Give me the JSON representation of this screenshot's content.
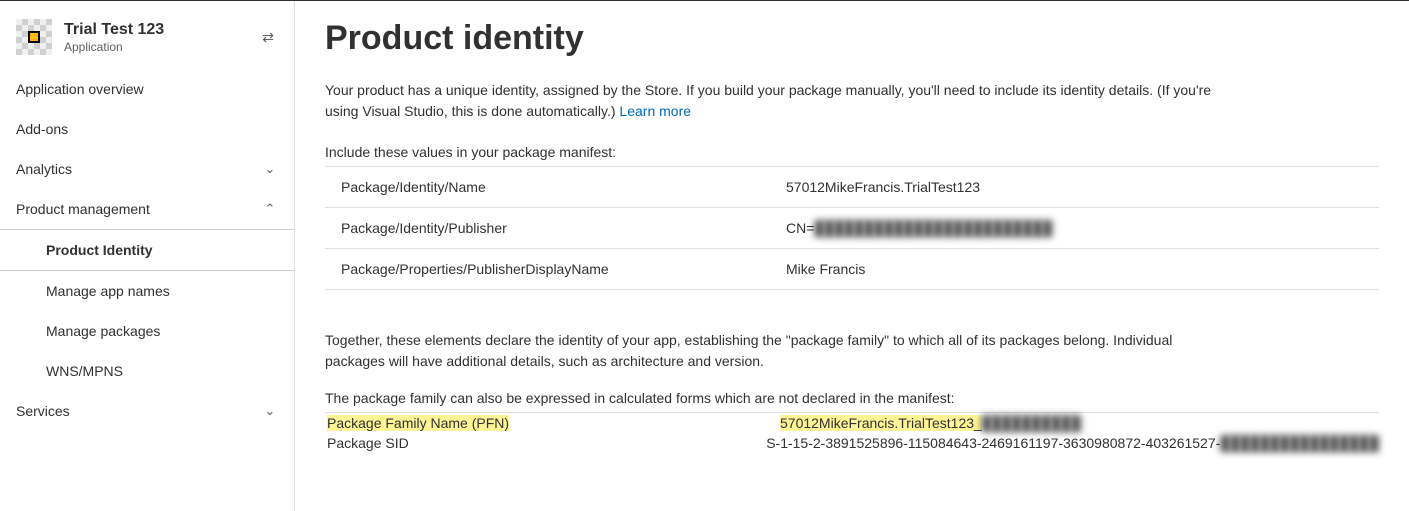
{
  "sidebar": {
    "app_title": "Trial Test 123",
    "app_subtitle": "Application",
    "items": [
      {
        "label": "Application overview",
        "kind": "link"
      },
      {
        "label": "Add-ons",
        "kind": "link"
      },
      {
        "label": "Analytics",
        "kind": "expandable",
        "expanded": false
      },
      {
        "label": "Product management",
        "kind": "expandable",
        "expanded": true,
        "children": [
          {
            "label": "Product Identity",
            "active": true
          },
          {
            "label": "Manage app names"
          },
          {
            "label": "Manage packages"
          },
          {
            "label": "WNS/MPNS"
          }
        ]
      },
      {
        "label": "Services",
        "kind": "expandable",
        "expanded": false
      }
    ]
  },
  "main": {
    "title": "Product identity",
    "description_pre": "Your product has a unique identity, assigned by the Store. If you build your package manually, you'll need to include its identity details. (If you're using Visual Studio, this is done automatically.)",
    "learn_more": "Learn more",
    "manifest_intro": "Include these values in your package manifest:",
    "manifest_rows": [
      {
        "key": "Package/Identity/Name",
        "value": "57012MikeFrancis.TrialTest123"
      },
      {
        "key": "Package/Identity/Publisher",
        "value_prefix": "CN=",
        "value_blurred": "████████████████████████"
      },
      {
        "key": "Package/Properties/PublisherDisplayName",
        "value": "Mike Francis"
      }
    ],
    "together_para": "Together, these elements declare the identity of your app, establishing the \"package family\" to which all of its packages belong. Individual packages will have additional details, such as architecture and version.",
    "calc_intro": "The package family can also be expressed in calculated forms which are not declared in the manifest:",
    "calc_rows": [
      {
        "key": "Package Family Name (PFN)",
        "value_prefix": "57012MikeFrancis.TrialTest123_",
        "value_blurred": "██████████",
        "highlight": true
      },
      {
        "key": "Package SID",
        "value_prefix": "S-1-15-2-3891525896-115084643-2469161197-3630980872-403261527-",
        "value_blurred": "████████████████"
      }
    ]
  }
}
